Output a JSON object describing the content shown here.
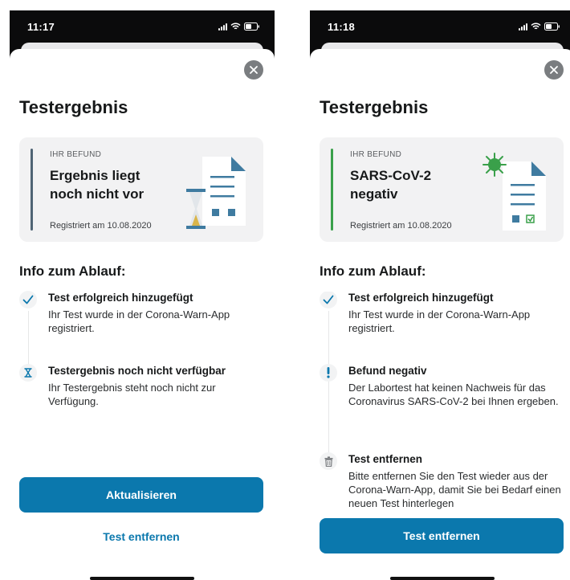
{
  "left": {
    "status_time": "11:17",
    "title": "Testergebnis",
    "card": {
      "kicker": "IHR BEFUND",
      "result": "Ergebnis liegt\nnoch nicht vor",
      "registered": "Registriert am 10.08.2020",
      "accent": "#4f6474"
    },
    "section_title": "Info zum Ablauf:",
    "steps": [
      {
        "icon": "checkmark-icon",
        "title": "Test erfolgreich hinzugefügt",
        "text": "Ihr Test wurde in der Corona-Warn-App registriert."
      },
      {
        "icon": "hourglass-icon",
        "title": "Testergebnis noch nicht verfügbar",
        "text": "Ihr Testergebnis steht noch nicht zur Verfügung."
      }
    ],
    "primary_button": "Aktualisieren",
    "link_button": "Test entfernen"
  },
  "right": {
    "status_time": "11:18",
    "title": "Testergebnis",
    "card": {
      "kicker": "IHR BEFUND",
      "result": "SARS-CoV-2\nnegativ",
      "registered": "Registriert am 10.08.2020",
      "accent": "#3aa04a"
    },
    "section_title": "Info zum Ablauf:",
    "steps": [
      {
        "icon": "checkmark-icon",
        "title": "Test erfolgreich hinzugefügt",
        "text": "Ihr Test wurde in der Corona-Warn-App registriert."
      },
      {
        "icon": "exclamation-icon",
        "title": "Befund negativ",
        "text": "Der Labortest hat keinen Nachweis für das Coronavirus SARS-CoV-2 bei Ihnen ergeben."
      },
      {
        "icon": "trash-icon",
        "title": "Test entfernen",
        "text": "Bitte entfernen Sie den Test wieder aus der Corona-Warn-App, damit Sie bei Bedarf einen neuen Test hinterlegen"
      }
    ],
    "primary_button": "Test entfernen"
  },
  "colors": {
    "primary": "#0b78ad",
    "card_bg": "#f2f2f3",
    "document_blue": "#3f7ba0",
    "virus_green": "#3aa04a"
  }
}
